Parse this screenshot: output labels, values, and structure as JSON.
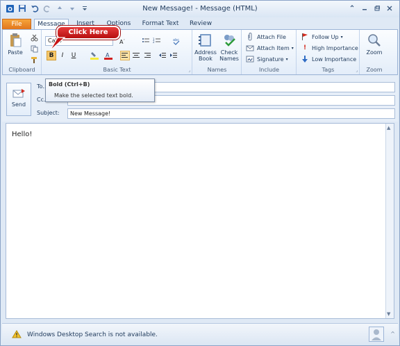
{
  "window": {
    "title": "New Message!  -  Message (HTML)"
  },
  "qat": {
    "icons": [
      "outlook-icon",
      "save-icon",
      "undo-icon",
      "redo-icon",
      "up-arrow-icon",
      "down-arrow-icon",
      "customize-icon"
    ]
  },
  "tabs": {
    "file": "File",
    "message": "Message",
    "insert": "Insert",
    "options": "Options",
    "format_text": "Format Text",
    "review": "Review"
  },
  "ribbon": {
    "clipboard": {
      "paste": "Paste",
      "label": "Clipboard"
    },
    "basic_text": {
      "font_name": "Calib",
      "label": "Basic Text"
    },
    "names": {
      "address_book": "Address\nBook",
      "address_book_l1": "Address",
      "address_book_l2": "Book",
      "check_names_l1": "Check",
      "check_names_l2": "Names",
      "label": "Names"
    },
    "include": {
      "attach_file": "Attach File",
      "attach_item": "Attach Item",
      "signature": "Signature",
      "label": "Include"
    },
    "tags": {
      "follow_up": "Follow Up",
      "high_importance": "High Importance",
      "low_importance": "Low Importance",
      "label": "Tags"
    },
    "zoom": {
      "zoom": "Zoom",
      "label": "Zoom"
    }
  },
  "callout": {
    "text": "Click Here"
  },
  "tooltip": {
    "title": "Bold (Ctrl+B)",
    "description": "Make the selected text bold."
  },
  "address": {
    "send": "Send",
    "to_label": "To...",
    "cc_label": "Cc...",
    "subject_label": "Subject:",
    "subject_value": "New Message!"
  },
  "body": {
    "text": "Hello!"
  },
  "status": {
    "text": "Windows Desktop Search is not available."
  },
  "colors": {
    "file_tab": "#e0731b",
    "callout": "#c81414",
    "ribbon_border": "#9cb4d6"
  }
}
